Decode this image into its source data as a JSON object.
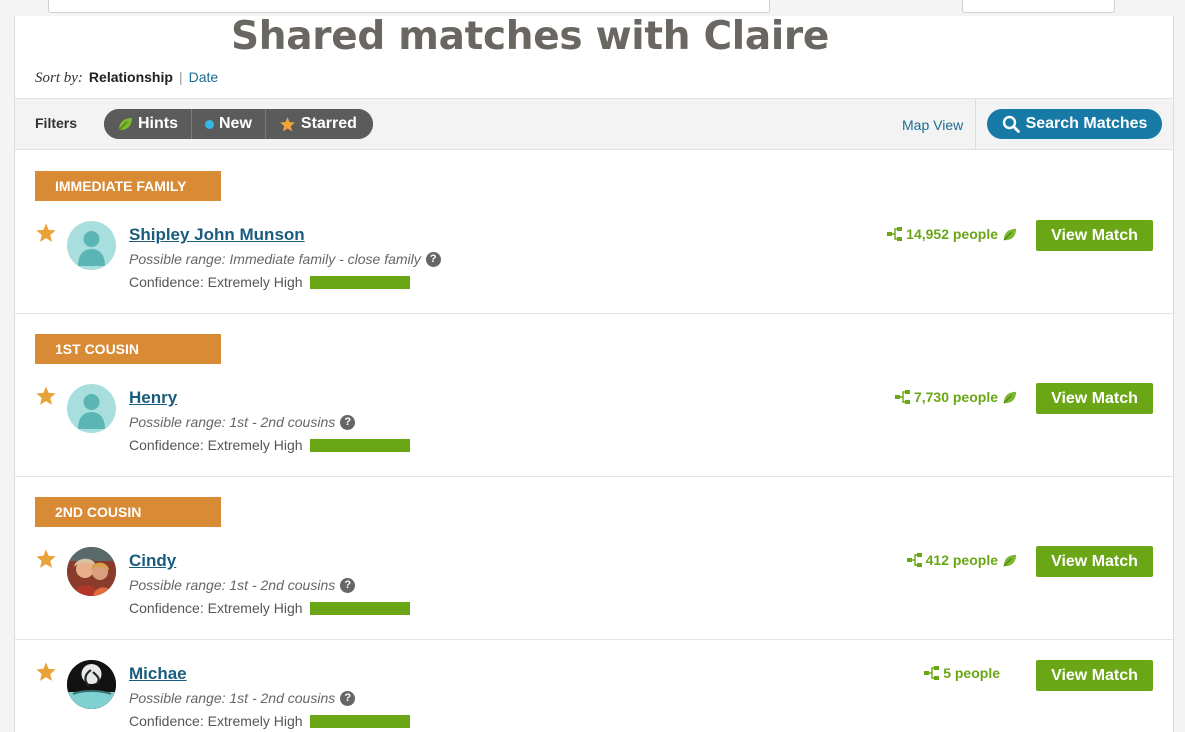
{
  "page": {
    "title": "Shared matches with Claire"
  },
  "sort": {
    "label": "Sort by:",
    "active": "Relationship",
    "separator": "|",
    "alternate": "Date"
  },
  "filters": {
    "label": "Filters",
    "pills": [
      {
        "label": "Hints",
        "icon": "leaf-icon"
      },
      {
        "label": "New",
        "icon": "new-dot-icon"
      },
      {
        "label": "Starred",
        "icon": "star-icon"
      }
    ],
    "map_view": "Map View",
    "search_button": "Search Matches"
  },
  "colors": {
    "relationship_label": "#d98a35",
    "accent_green": "#6aa615",
    "link_blue": "#1a6c92",
    "search_blue": "#177aa6",
    "star": "#e8a23a"
  },
  "groups": [
    {
      "relationship": "IMMEDIATE FAMILY",
      "match": {
        "name": "Shipley John Munson",
        "range": "Possible range: Immediate family - close family",
        "confidence": "Confidence: Extremely High",
        "confidence_level": 1.0,
        "people": "14,952 people",
        "has_hint_leaf": true,
        "avatar": "silhouette-avatar",
        "button": "View Match"
      }
    },
    {
      "relationship": "1ST COUSIN",
      "match": {
        "name": "Henry",
        "range": "Possible range: 1st - 2nd cousins",
        "confidence": "Confidence: Extremely High",
        "confidence_level": 1.0,
        "people": "7,730 people",
        "has_hint_leaf": true,
        "avatar": "silhouette-avatar",
        "button": "View Match"
      }
    },
    {
      "relationship": "2ND COUSIN",
      "match": {
        "name": "Cindy",
        "range": "Possible range: 1st - 2nd cousins",
        "confidence": "Confidence: Extremely High",
        "confidence_level": 1.0,
        "people": "412 people",
        "has_hint_leaf": true,
        "avatar": "photo-avatar",
        "button": "View Match"
      }
    },
    {
      "relationship": "",
      "match": {
        "name": "Michae",
        "range": "Possible range: 1st - 2nd cousins",
        "confidence": "Confidence: Extremely High",
        "confidence_level": 1.0,
        "people": "5 people",
        "has_hint_leaf": false,
        "avatar": "photo-avatar",
        "button": "View Match"
      }
    }
  ]
}
